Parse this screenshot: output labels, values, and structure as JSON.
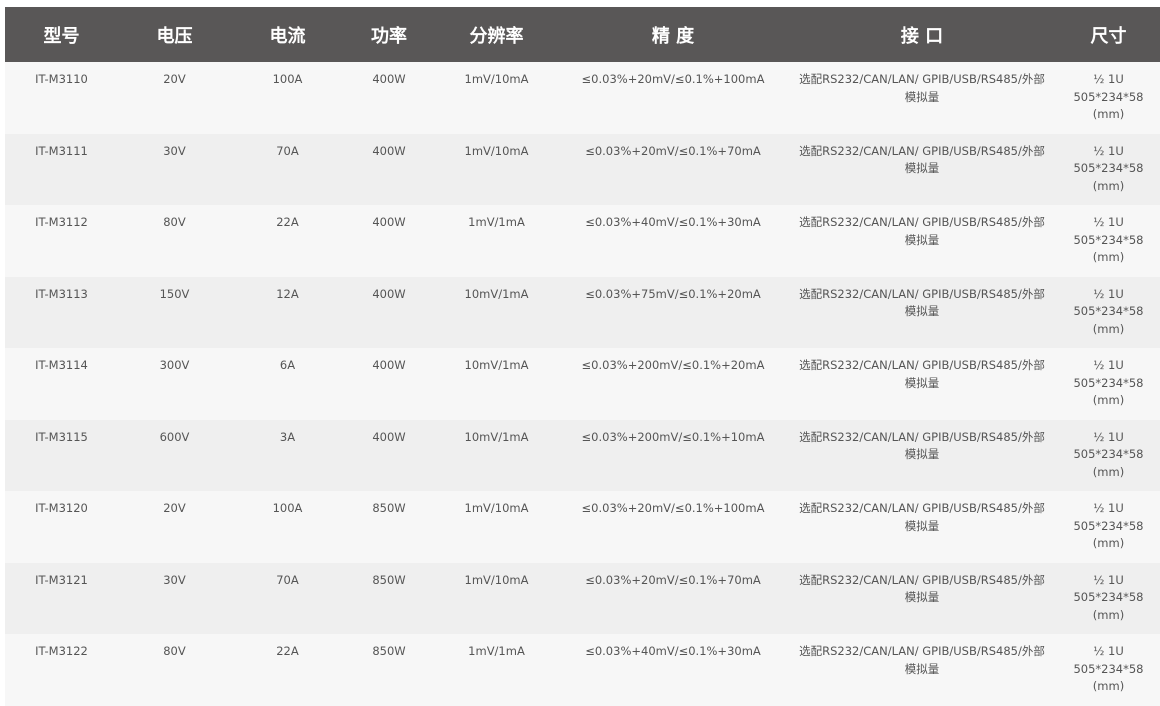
{
  "table": {
    "headers": [
      "型号",
      "电压",
      "电流",
      "功率",
      "分辨率",
      "精 度",
      "接 口",
      "尺寸"
    ],
    "rows": [
      {
        "model": "IT-M3110",
        "voltage": "20V",
        "current": "100A",
        "power": "400W",
        "resolution": "1mV/10mA",
        "accuracy": "≤0.03%+20mV/≤0.1%+100mA",
        "interface": "选配RS232/CAN/LAN/ GPIB/USB/RS485/外部模拟量",
        "size_line1": "½ 1U",
        "size_line2": "505*234*58",
        "size_line3": "(mm)"
      },
      {
        "model": "IT-M3111",
        "voltage": "30V",
        "current": "70A",
        "power": "400W",
        "resolution": "1mV/10mA",
        "accuracy": "≤0.03%+20mV/≤0.1%+70mA",
        "interface": "选配RS232/CAN/LAN/ GPIB/USB/RS485/外部模拟量",
        "size_line1": "½ 1U",
        "size_line2": "505*234*58",
        "size_line3": "(mm)"
      },
      {
        "model": "IT-M3112",
        "voltage": "80V",
        "current": "22A",
        "power": "400W",
        "resolution": "1mV/1mA",
        "accuracy": "≤0.03%+40mV/≤0.1%+30mA",
        "interface": "选配RS232/CAN/LAN/ GPIB/USB/RS485/外部模拟量",
        "size_line1": "½ 1U",
        "size_line2": "505*234*58",
        "size_line3": "(mm)"
      },
      {
        "model": "IT-M3113",
        "voltage": "150V",
        "current": "12A",
        "power": "400W",
        "resolution": "10mV/1mA",
        "accuracy": "≤0.03%+75mV/≤0.1%+20mA",
        "interface": "选配RS232/CAN/LAN/ GPIB/USB/RS485/外部模拟量",
        "size_line1": "½ 1U",
        "size_line2": "505*234*58",
        "size_line3": "(mm)"
      },
      {
        "model": "IT-M3114",
        "voltage": "300V",
        "current": "6A",
        "power": "400W",
        "resolution": "10mV/1mA",
        "accuracy": "≤0.03%+200mV/≤0.1%+20mA",
        "interface": "选配RS232/CAN/LAN/ GPIB/USB/RS485/外部模拟量",
        "size_line1": "½ 1U",
        "size_line2": "505*234*58",
        "size_line3": "(mm)"
      },
      {
        "model": "IT-M3115",
        "voltage": "600V",
        "current": "3A",
        "power": "400W",
        "resolution": "10mV/1mA",
        "accuracy": "≤0.03%+200mV/≤0.1%+10mA",
        "interface": "选配RS232/CAN/LAN/ GPIB/USB/RS485/外部模拟量",
        "size_line1": "½ 1U",
        "size_line2": "505*234*58",
        "size_line3": "(mm)"
      },
      {
        "model": "IT-M3120",
        "voltage": "20V",
        "current": "100A",
        "power": "850W",
        "resolution": "1mV/10mA",
        "accuracy": "≤0.03%+20mV/≤0.1%+100mA",
        "interface": "选配RS232/CAN/LAN/ GPIB/USB/RS485/外部模拟量",
        "size_line1": "½ 1U",
        "size_line2": "505*234*58",
        "size_line3": "(mm)"
      },
      {
        "model": "IT-M3121",
        "voltage": "30V",
        "current": "70A",
        "power": "850W",
        "resolution": "1mV/10mA",
        "accuracy": "≤0.03%+20mV/≤0.1%+70mA",
        "interface": "选配RS232/CAN/LAN/ GPIB/USB/RS485/外部模拟量",
        "size_line1": "½ 1U",
        "size_line2": "505*234*58",
        "size_line3": "(mm)"
      },
      {
        "model": "IT-M3122",
        "voltage": "80V",
        "current": "22A",
        "power": "850W",
        "resolution": "1mV/1mA",
        "accuracy": "≤0.03%+40mV/≤0.1%+30mA",
        "interface": "选配RS232/CAN/LAN/ GPIB/USB/RS485/外部模拟量",
        "size_line1": "½ 1U",
        "size_line2": "505*234*58",
        "size_line3": "(mm)"
      }
    ]
  },
  "colors": {
    "header_background": "#595757",
    "header_text": "#ffffff",
    "row_odd": "#f7f7f7",
    "row_even": "#efefef",
    "cell_text": "#555555"
  }
}
